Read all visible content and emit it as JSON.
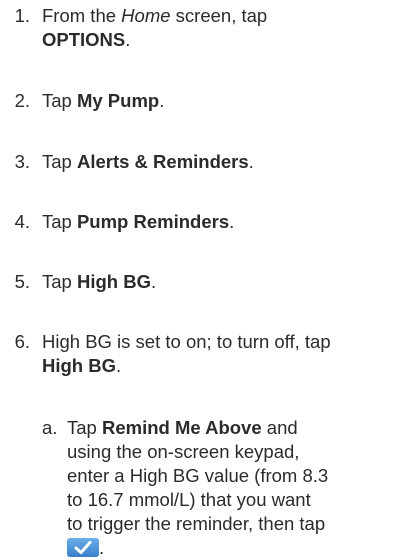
{
  "steps": [
    {
      "num": "1.",
      "part1": "From the ",
      "italic": "Home",
      "part2": " screen, tap",
      "bold": "OPTIONS",
      "end": "."
    },
    {
      "num": "2.",
      "pre": "Tap ",
      "bold": "My Pump",
      "end": "."
    },
    {
      "num": "3.",
      "pre": "Tap ",
      "bold": "Alerts & Reminders",
      "end": "."
    },
    {
      "num": "4.",
      "pre": "Tap ",
      "bold": "Pump Reminders",
      "end": "."
    },
    {
      "num": "5.",
      "pre": "Tap ",
      "bold": "High BG",
      "end": "."
    },
    {
      "num": "6.",
      "line1": "High BG is set to on; to turn off, tap",
      "bold": "High BG",
      "end": "."
    }
  ],
  "substep": {
    "letter": "a.",
    "pre": "Tap ",
    "bold": "Remind Me Above",
    "line1_end": " and",
    "line2": "using the on-screen keypad,",
    "line3": "enter a High BG value (from 8.3",
    "line4": "to 16.7 mmol/L) that you want",
    "line5": "to trigger the reminder, then tap",
    "end": "."
  },
  "icons": {
    "confirm": "check-button-icon"
  }
}
